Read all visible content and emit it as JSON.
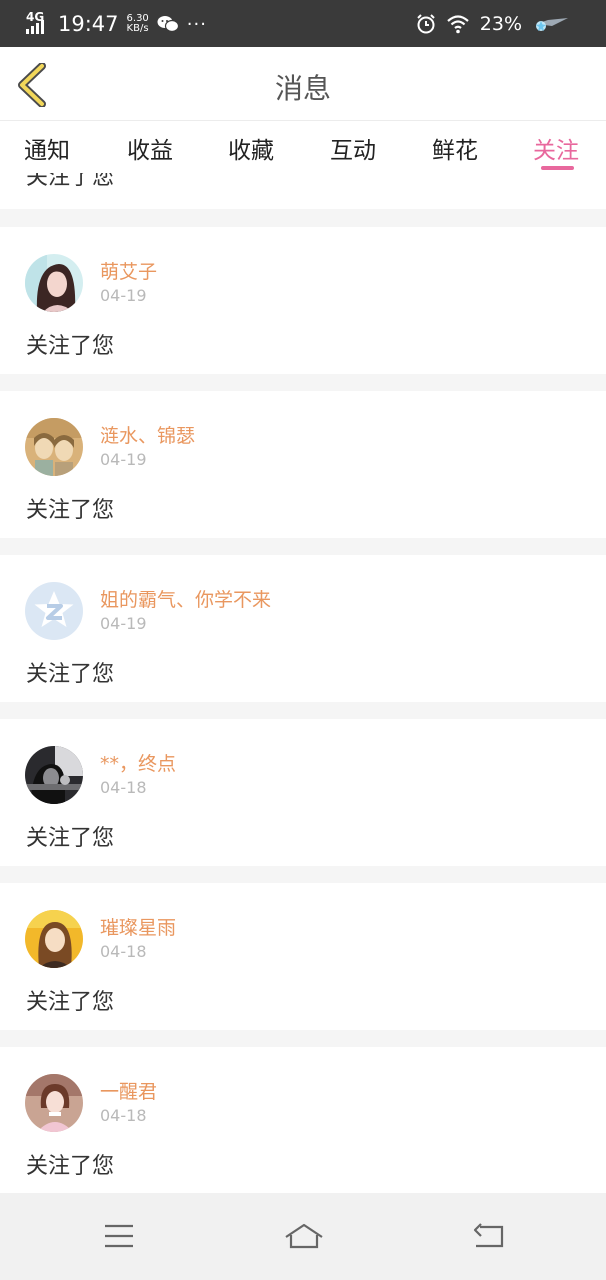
{
  "status_bar": {
    "network": "4G",
    "time": "19:47",
    "speed_value": "6.30",
    "speed_unit": "KB/s",
    "more": "···",
    "battery": "23%"
  },
  "header": {
    "title": "消息"
  },
  "tabs": [
    {
      "label": "通知"
    },
    {
      "label": "收益"
    },
    {
      "label": "收藏"
    },
    {
      "label": "互动"
    },
    {
      "label": "鲜花"
    },
    {
      "label": "关注",
      "active": true
    }
  ],
  "partial_message": "关注了您",
  "items": [
    {
      "name": "萌艾子",
      "date": "04-19",
      "message": "关注了您"
    },
    {
      "name": "涟水、锦瑟",
      "date": "04-19",
      "message": "关注了您"
    },
    {
      "name": "姐的霸气、你学不来",
      "date": "04-19",
      "message": "关注了您"
    },
    {
      "name": "**，终点",
      "date": "04-18",
      "message": "关注了您"
    },
    {
      "name": "璀璨星雨",
      "date": "04-18",
      "message": "关注了您"
    },
    {
      "name": "一醒君",
      "date": "04-18",
      "message": "关注了您"
    }
  ],
  "colors": {
    "accent": "#e8689d",
    "name": "#e9975f",
    "date": "#b9b9b9",
    "back_arrow": "#f2d75a"
  },
  "icons": {
    "back": "chevron-left-icon",
    "menu": "menu-icon",
    "home": "home-icon",
    "return": "return-icon"
  }
}
